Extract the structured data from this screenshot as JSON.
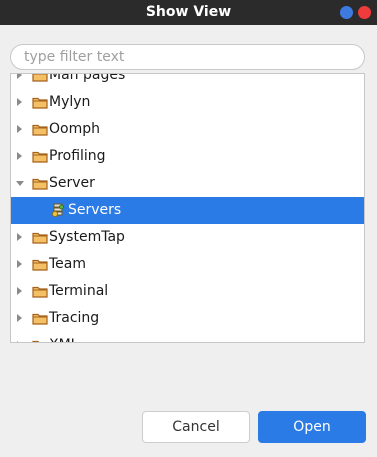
{
  "window": {
    "title": "Show View",
    "dot_colors": [
      "#3d7be0",
      "#ef3b3b"
    ]
  },
  "filter": {
    "placeholder": "type filter text",
    "value": ""
  },
  "tree": {
    "items": [
      {
        "label": "Man pages",
        "type": "folder",
        "expanded": false,
        "selected": false
      },
      {
        "label": "Mylyn",
        "type": "folder",
        "expanded": false,
        "selected": false
      },
      {
        "label": "Oomph",
        "type": "folder",
        "expanded": false,
        "selected": false
      },
      {
        "label": "Profiling",
        "type": "folder",
        "expanded": false,
        "selected": false
      },
      {
        "label": "Server",
        "type": "folder",
        "expanded": true,
        "selected": false
      },
      {
        "label": "Servers",
        "type": "view",
        "icon": "servers-icon",
        "selected": true
      },
      {
        "label": "SystemTap",
        "type": "folder",
        "expanded": false,
        "selected": false
      },
      {
        "label": "Team",
        "type": "folder",
        "expanded": false,
        "selected": false
      },
      {
        "label": "Terminal",
        "type": "folder",
        "expanded": false,
        "selected": false
      },
      {
        "label": "Tracing",
        "type": "folder",
        "expanded": false,
        "selected": false
      },
      {
        "label": "XML",
        "type": "folder",
        "expanded": false,
        "selected": false
      }
    ]
  },
  "buttons": {
    "cancel": "Cancel",
    "open": "Open"
  },
  "colors": {
    "selection": "#2b7be6",
    "folder_outline": "#a5621a",
    "folder_fill": "#f3c066"
  }
}
